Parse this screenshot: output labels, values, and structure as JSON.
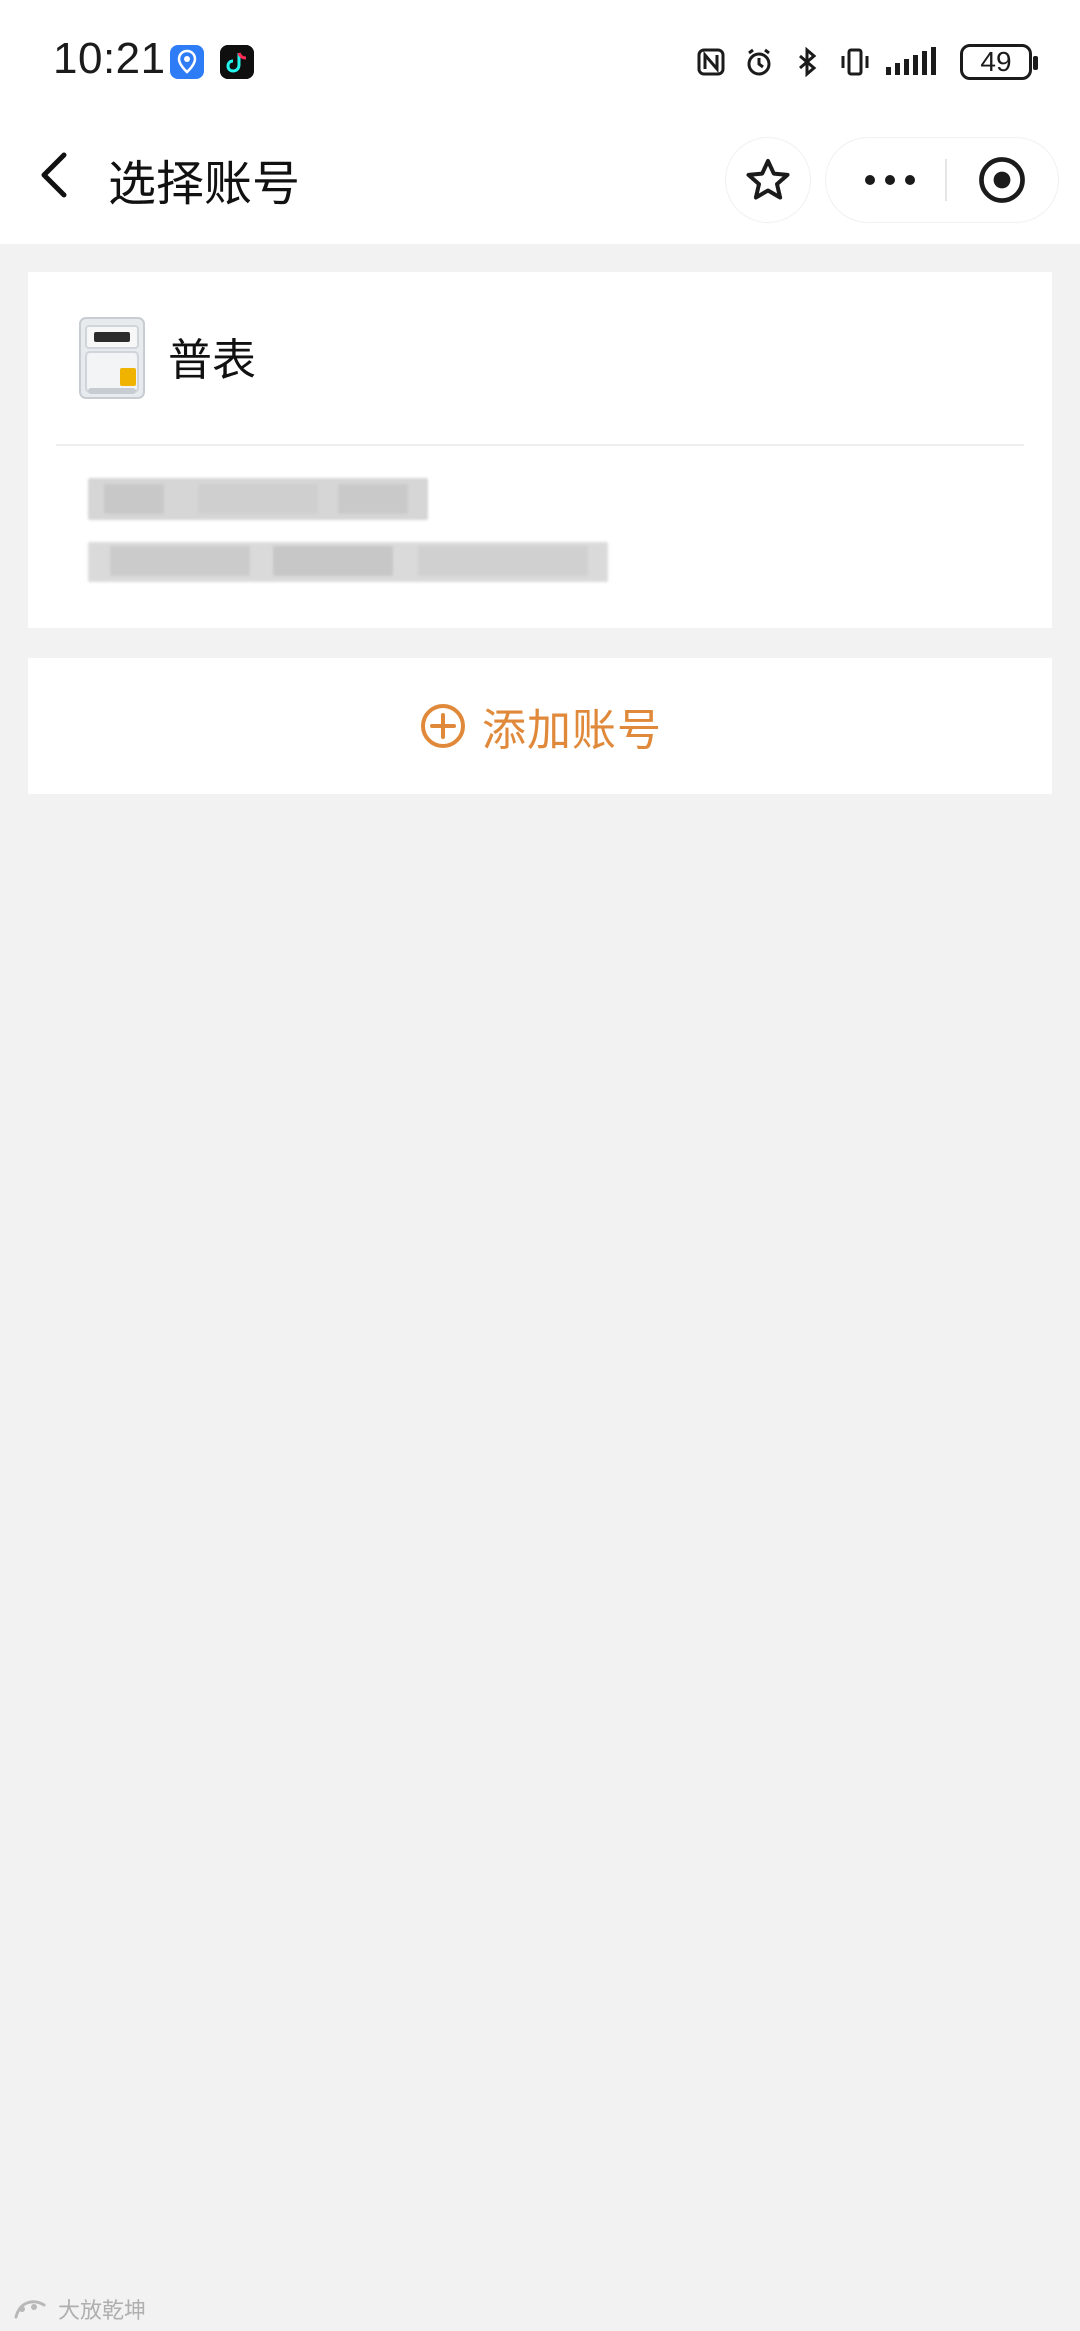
{
  "status_bar": {
    "time": "10:21",
    "battery": "49",
    "apps": [
      "maps-app-icon",
      "tiktok-app-icon"
    ],
    "icons": [
      "nfc-icon",
      "alarm-icon",
      "bluetooth-icon",
      "vibrate-icon",
      "signal-icon"
    ]
  },
  "nav": {
    "title": "选择账号",
    "back_icon": "chevron-left-icon",
    "favorite_icon": "star-icon",
    "more_icon": "ellipsis-icon",
    "close_icon": "target-icon"
  },
  "account": {
    "meter_name": "普表",
    "meter_icon": "gas-meter-image",
    "obscured": true
  },
  "add_account": {
    "label": "添加账号",
    "icon": "plus-circle-icon",
    "accent_color": "#e0893a"
  },
  "watermark": {
    "text": "大放乾坤"
  },
  "colors": {
    "background": "#f2f2f2",
    "surface": "#ffffff",
    "accent": "#e0893a"
  }
}
